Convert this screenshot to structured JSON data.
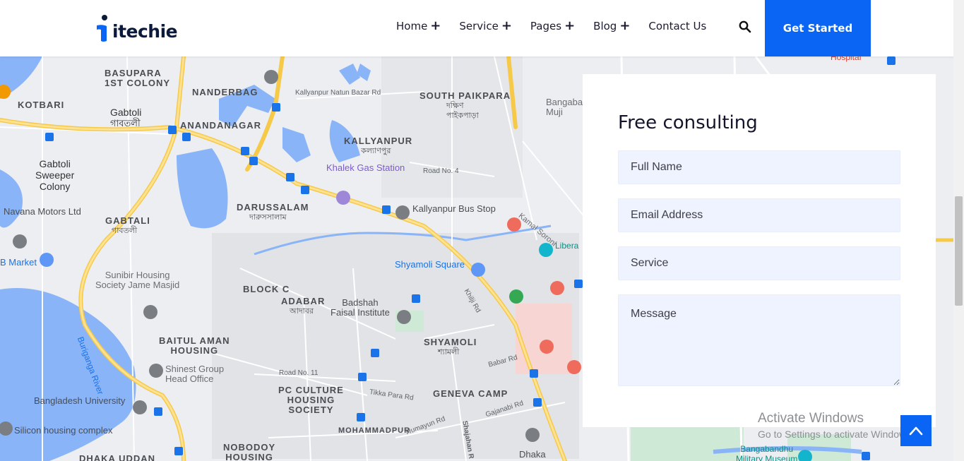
{
  "brand": {
    "name": "itechie"
  },
  "nav": {
    "items": [
      {
        "label": "Home",
        "has_submenu": true
      },
      {
        "label": "Service",
        "has_submenu": true
      },
      {
        "label": "Pages",
        "has_submenu": true
      },
      {
        "label": "Blog",
        "has_submenu": true
      },
      {
        "label": "Contact Us",
        "has_submenu": false
      }
    ],
    "search_icon": "search-icon",
    "cta_label": "Get Started"
  },
  "map": {
    "labels": {
      "basupara": "BASUPARA\n1ST COLONY",
      "kotbari": "KOTBARI",
      "gabtoli": "Gabtoli",
      "gabtoli_bn": "গাবতলী",
      "nanderbag": "NANDERBAG",
      "anandanagar": "ANANDANAGAR",
      "south_paikpara": "SOUTH PAIKPARA",
      "south_paikpara_bn": "দক্ষিণ\nপাইকপাড়া",
      "kallyanpur": "KALLYANPUR",
      "kallyanpur_bn": "কল্যাণপুর",
      "khalek": "Khalek Gas Station",
      "gabtoli_sweeper": "Gabtoli\nSweeper\nColony",
      "navana": "Navana Motors Ltd",
      "gabtali": "GABTALI",
      "gabtali_bn": "গাবতলী",
      "darussalam": "DARUSSALAM",
      "darussalam_bn": "দারুসসালাম",
      "kallyanpur_bus": "Kallyanpur Bus Stop",
      "kamal_soroni": "Kamal Soroni",
      "b_market": "B Market",
      "sunibir": "Sunibir Housing\nSociety Jame Masjid",
      "block_c": "BLOCK C",
      "adabar": "ADABAR",
      "adabar_bn": "আদাবর",
      "shyamoli_square": "Shyamoli Square",
      "badshah": "Badshah\nFaisal Institute",
      "baitul": "BAITUL AMAN\nHOUSING",
      "shyamoli": "SHYAMOLI",
      "shyamoli_bn": "শ্যামলী",
      "shinest": "Shinest Group\nHead Office",
      "buriganga": "Buriganga River",
      "pc_culture": "PC CULTURE\nHOUSING\nSOCIETY",
      "geneva": "GENEVA CAMP",
      "bd_university": "Bangladesh University",
      "silicon": "Silicon housing complex",
      "mohammadpur": "MOHAMMADPUR",
      "nobodoy": "NOBODOY\nHOUSING",
      "dhaka_uddan": "DHAKA UDDAN",
      "dhaka": "Dhaka",
      "bangabandhu": "Bangabandhu\nMilitary Museum",
      "kallyanpur_natun_bazar": "Kallyanpur Natun Bazar Rd",
      "road_no_4": "Road No. 4",
      "humayun": "Humayun Rd",
      "gajanabi": "Gajanabi Rd",
      "tikka": "Tikka Para Rd",
      "babar": "Babar Rd",
      "road_11": "Road No. 11",
      "khilji": "Khilji Rd",
      "shajahan": "Shajahan R",
      "hospital": "Hospital",
      "bangaba": "Bangaba\nMuji",
      "libera": "Libera"
    }
  },
  "form": {
    "title": "Free consulting",
    "full_name_placeholder": "Full Name",
    "email_placeholder": "Email Address",
    "service_placeholder": "Service",
    "message_placeholder": "Message"
  },
  "watermark": {
    "line1": "Activate Windows",
    "line2": "Go to Settings to activate Windows."
  },
  "colors": {
    "accent": "#0a64f4",
    "map_water": "#8ab4f8",
    "map_road_major": "#fdd663"
  }
}
